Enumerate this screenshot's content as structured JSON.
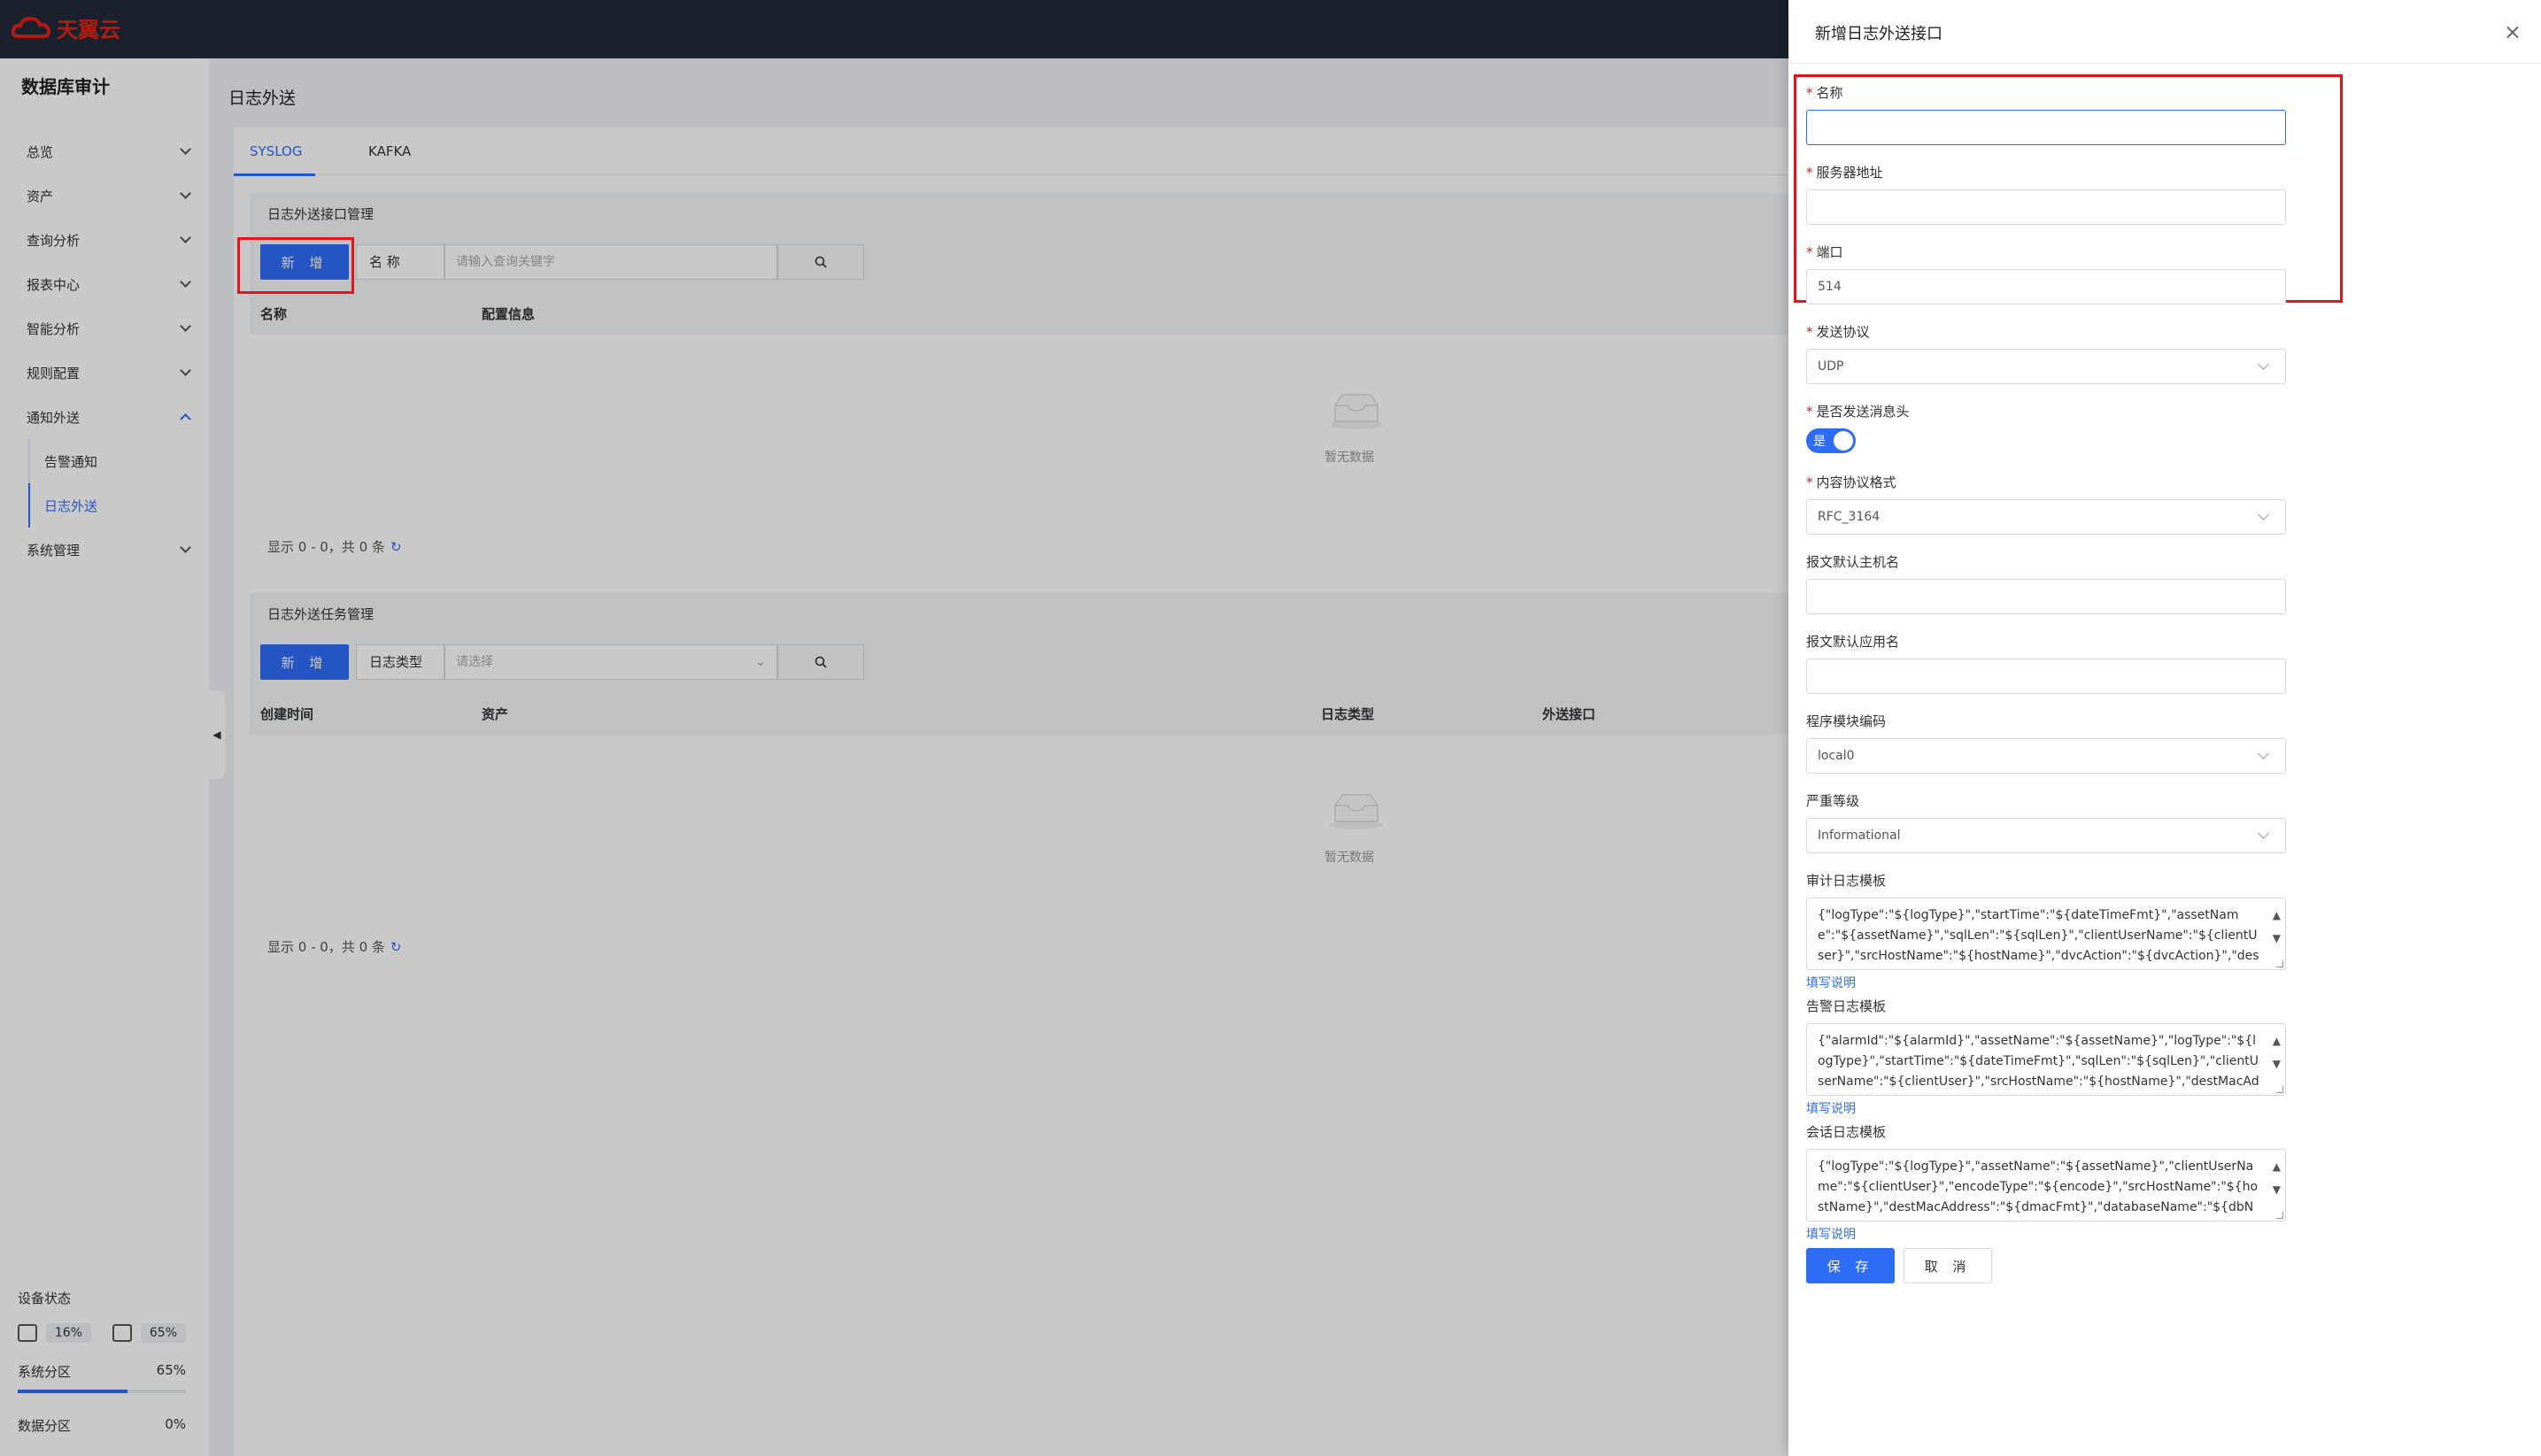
{
  "header": {
    "logo_text": "天翼云",
    "brand_color": "#e2231a"
  },
  "sidebar": {
    "app_title": "数据库审计",
    "items": [
      {
        "label": "总览"
      },
      {
        "label": "资产"
      },
      {
        "label": "查询分析"
      },
      {
        "label": "报表中心"
      },
      {
        "label": "智能分析"
      },
      {
        "label": "规则配置"
      },
      {
        "label": "通知外送"
      },
      {
        "label": "告警通知"
      },
      {
        "label": "日志外送"
      },
      {
        "label": "系统管理"
      }
    ],
    "device": {
      "title": "设备状态",
      "cpu": "16%",
      "memory": "65%",
      "system_partition_label": "系统分区",
      "system_partition_value": "65%",
      "system_partition_fraction": 0.65,
      "data_partition_label": "数据分区",
      "data_partition_value": "0%"
    }
  },
  "main": {
    "page_title": "日志外送",
    "tabs": [
      {
        "label": "SYSLOG"
      },
      {
        "label": "KAFKA"
      }
    ],
    "interface_section": {
      "title": "日志外送接口管理",
      "add_label": "新 增",
      "filter_label": "名 称",
      "search_placeholder": "请输入查询关键字",
      "columns": [
        "名称",
        "配置信息"
      ],
      "empty_text": "暂无数据",
      "pager": "显示 0 - 0，共 0 条"
    },
    "task_section": {
      "title": "日志外送任务管理",
      "add_label": "新 增",
      "filter_label": "日志类型",
      "select_placeholder": "请选择",
      "columns": [
        "创建时间",
        "资产",
        "日志类型",
        "外送接口"
      ],
      "empty_text": "暂无数据",
      "pager": "显示 0 - 0，共 0 条"
    }
  },
  "drawer": {
    "title": "新增日志外送接口",
    "fields": {
      "name_label": "名称",
      "name_value": "",
      "server_label": "服务器地址",
      "server_value": "",
      "port_label": "端口",
      "port_value": "514",
      "protocol_label": "发送协议",
      "protocol_value": "UDP",
      "send_header_label": "是否发送消息头",
      "send_header_value": "是",
      "format_label": "内容协议格式",
      "format_value": "RFC_3164",
      "hostname_label": "报文默认主机名",
      "hostname_value": "",
      "appname_label": "报文默认应用名",
      "appname_value": "",
      "facility_label": "程序模块编码",
      "facility_value": "local0",
      "severity_label": "严重等级",
      "severity_value": "Informational",
      "audit_template_label": "审计日志模板",
      "audit_template_value": "{\"logType\":\"${logType}\",\"startTime\":\"${dateTimeFmt}\",\"assetName\":\"${assetName}\",\"sqlLen\":\"${sqlLen}\",\"clientUserName\":\"${clientUser}\",\"srcHostName\":\"${hostName}\",\"dvcAction\":\"${dvcAction}\",\"destMacAddress\":\"${",
      "alarm_template_label": "告警日志模板",
      "alarm_template_value": "{\"alarmId\":\"${alarmId}\",\"assetName\":\"${assetName}\",\"logType\":\"${logType}\",\"startTime\":\"${dateTimeFmt}\",\"sqlLen\":\"${sqlLen}\",\"clientUserName\":\"${clientUser}\",\"srcHostName\":\"${hostName}\",\"destMacAddress\":\"${dma",
      "session_template_label": "会话日志模板",
      "session_template_value": "{\"logType\":\"${logType}\",\"assetName\":\"${assetName}\",\"clientUserName\":\"${clientUser}\",\"encodeType\":\"${encode}\",\"srcHostName\":\"${hostName}\",\"destMacAddress\":\"${dmacFmt}\",\"databaseName\":\"${dbName}\",\"srcMacAd",
      "help_link": "填写说明"
    },
    "save_label": "保 存",
    "cancel_label": "取 消"
  }
}
